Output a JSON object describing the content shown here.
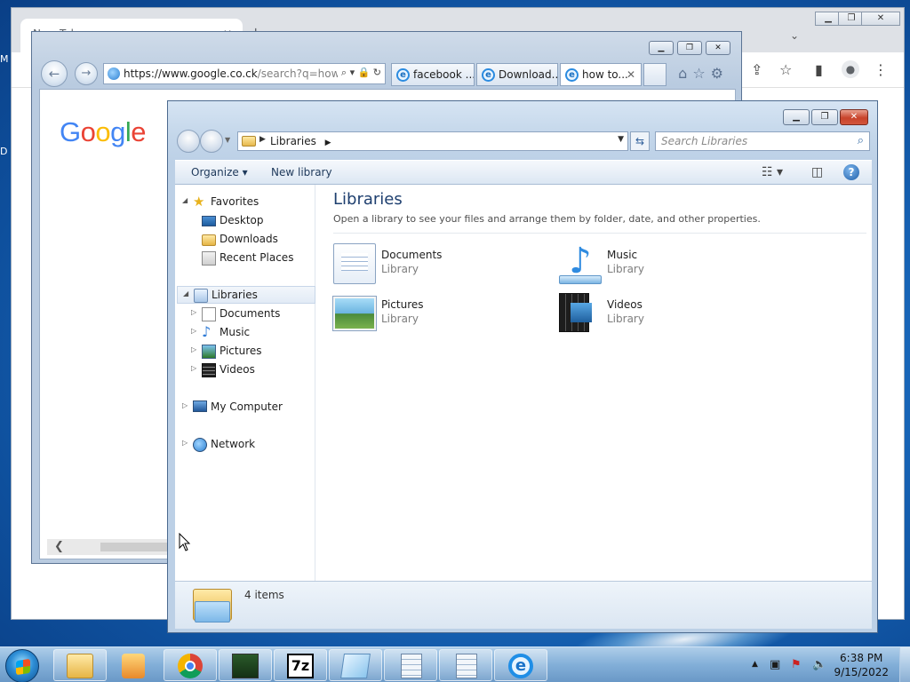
{
  "desktop": {
    "edge_letters": [
      "M",
      "D"
    ]
  },
  "chrome": {
    "tab_title": "New Tab",
    "tab_close": "✕",
    "new_tab": "+",
    "menu_arrow": "⌄",
    "toolbar_icons": {
      "share": "⇪",
      "star": "☆",
      "sidepanel": "▮",
      "profile": "●",
      "menu": "⋮"
    }
  },
  "ie": {
    "address": "https://www.google.co.ck",
    "address_dim": "/search?q=how",
    "addr_tools": "⌕ ▾ 🔒 ↻",
    "tabs": [
      {
        "label": "facebook ...",
        "active": false
      },
      {
        "label": "Download...",
        "active": false
      },
      {
        "label": "how to...",
        "active": true,
        "close": "✕"
      }
    ],
    "right_icons": "⌂☆⚙",
    "google": [
      "G",
      "o",
      "o",
      "g",
      "l",
      "e"
    ]
  },
  "explorer": {
    "path": "Libraries",
    "search_placeholder": "Search Libraries",
    "commands": {
      "organize": "Organize ▾",
      "new_library": "New library"
    },
    "nav": {
      "favorites": "Favorites",
      "favorites_items": [
        "Desktop",
        "Downloads",
        "Recent Places"
      ],
      "libraries": "Libraries",
      "libraries_items": [
        "Documents",
        "Music",
        "Pictures",
        "Videos"
      ],
      "computer": "My Computer",
      "network": "Network"
    },
    "content": {
      "title": "Libraries",
      "description": "Open a library to see your files and arrange them by folder, date, and other properties.",
      "items": [
        {
          "name": "Documents",
          "type": "Library"
        },
        {
          "name": "Music",
          "type": "Library"
        },
        {
          "name": "Pictures",
          "type": "Library"
        },
        {
          "name": "Videos",
          "type": "Library"
        }
      ]
    },
    "details": {
      "count": "4 items"
    }
  },
  "taskbar": {
    "apps": [
      "windows-explorer",
      "media-player",
      "chrome",
      "task-manager",
      "7zip",
      "notepad",
      "calculator",
      "calculator",
      "internet-explorer"
    ],
    "sevenzip_label": "7z",
    "clock": {
      "time": "6:38 PM",
      "date": "9/15/2022"
    }
  }
}
